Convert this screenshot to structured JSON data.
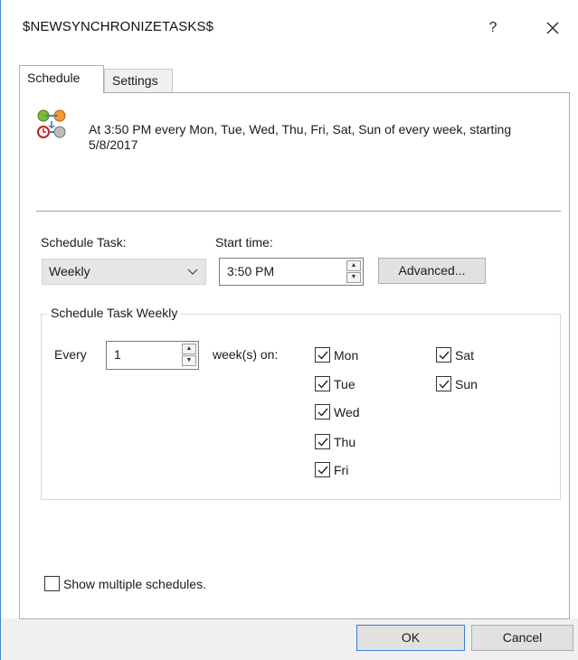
{
  "window": {
    "title": "$NEWSYNCHRONIZETASKS$",
    "help_label": "?",
    "close_icon": "close-icon"
  },
  "tabs": [
    {
      "label": "Schedule"
    },
    {
      "label": "Settings"
    }
  ],
  "schedule": {
    "summary": "At 3:50 PM every Mon, Tue, Wed, Thu, Fri, Sat, Sun of every week, starting 5/8/2017",
    "schedule_task_label": "Schedule Task:",
    "schedule_task_value": "Weekly",
    "start_time_label": "Start time:",
    "start_time_value": "3:50 PM",
    "advanced_label": "Advanced...",
    "weekly_group_title": "Schedule Task Weekly",
    "every_label": "Every",
    "every_value": "1",
    "weeks_on_label": "week(s) on:",
    "days": [
      {
        "label": "Mon",
        "checked": true
      },
      {
        "label": "Tue",
        "checked": true
      },
      {
        "label": "Wed",
        "checked": true
      },
      {
        "label": "Thu",
        "checked": true
      },
      {
        "label": "Fri",
        "checked": true
      },
      {
        "label": "Sat",
        "checked": true
      },
      {
        "label": "Sun",
        "checked": true
      }
    ],
    "show_multiple_label": "Show multiple schedules.",
    "show_multiple_checked": false
  },
  "footer": {
    "ok_label": "OK",
    "cancel_label": "Cancel"
  }
}
